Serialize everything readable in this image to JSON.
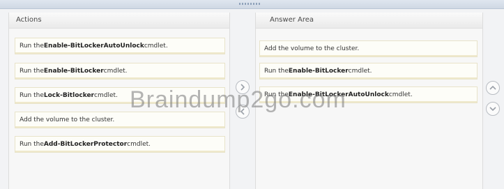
{
  "left_panel": {
    "title": "Actions",
    "items": [
      {
        "prefix": "Run the ",
        "bold": "Enable-BitLockerAutoUnlock",
        "suffix": " cmdlet."
      },
      {
        "prefix": "Run the ",
        "bold": "Enable-BitLocker",
        "suffix": " cmdlet."
      },
      {
        "prefix": "Run the ",
        "bold": "Lock-Bitlocker",
        "suffix": " cmdlet."
      },
      {
        "prefix": "Add the volume to the cluster.",
        "bold": "",
        "suffix": ""
      },
      {
        "prefix": "Run the ",
        "bold": "Add-BitLockerProtector",
        "suffix": " cmdlet."
      }
    ]
  },
  "right_panel": {
    "title": "Answer Area",
    "items": [
      {
        "prefix": "Add the volume to the cluster.",
        "bold": "",
        "suffix": ""
      },
      {
        "prefix": "Run the ",
        "bold": "Enable-BitLocker",
        "suffix": " cmdlet."
      },
      {
        "prefix": "Run the ",
        "bold": "Enable-BitLockerAutoUnlock",
        "suffix": " cmdlet."
      }
    ]
  },
  "icons": {
    "move_right": "chevron-right-icon",
    "move_left": "chevron-left-icon",
    "move_up": "chevron-up-icon",
    "move_down": "chevron-down-icon"
  },
  "watermark": "Braindump2go.com",
  "colors": {
    "background": "#f2f3f5",
    "item_bg": "#fdfdf8",
    "item_border": "#e8e3c9",
    "button_border": "#b8bcc2"
  }
}
